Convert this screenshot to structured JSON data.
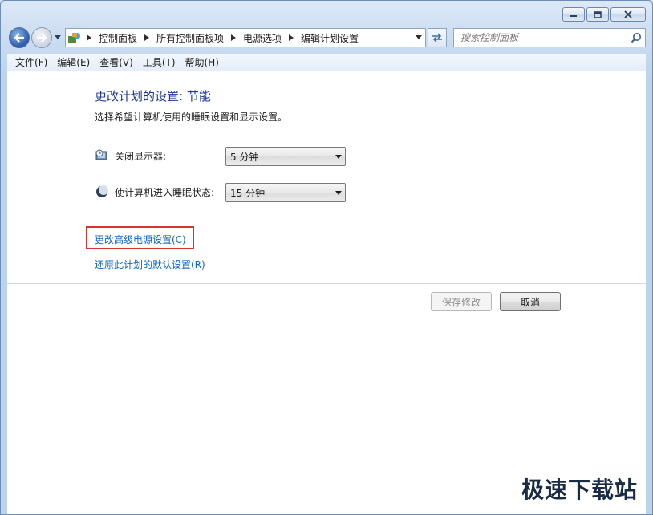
{
  "window": {
    "caption": {
      "minimize": "minimize",
      "maximize": "maximize",
      "close": "close"
    }
  },
  "nav": {
    "breadcrumbs": [
      "控制面板",
      "所有控制面板项",
      "电源选项",
      "编辑计划设置"
    ],
    "search": {
      "placeholder": "搜索控制面板"
    }
  },
  "menubar": {
    "items": [
      "文件(F)",
      "编辑(E)",
      "查看(V)",
      "工具(T)",
      "帮助(H)"
    ]
  },
  "content": {
    "title": "更改计划的设置: 节能",
    "subtitle": "选择希望计算机使用的睡眠设置和显示设置。",
    "display_off": {
      "label": "关闭显示器:",
      "value": "5 分钟"
    },
    "sleep": {
      "label": "使计算机进入睡眠状态:",
      "value": "15 分钟"
    },
    "advanced_link": "更改高级电源设置(C)",
    "restore_link": "还原此计划的默认设置(R)",
    "save_button": "保存修改",
    "cancel_button": "取消"
  },
  "watermark": "极速下载站",
  "colors": {
    "link": "#0b66c2",
    "title": "#1f3a93",
    "highlight": "#d6352f"
  }
}
